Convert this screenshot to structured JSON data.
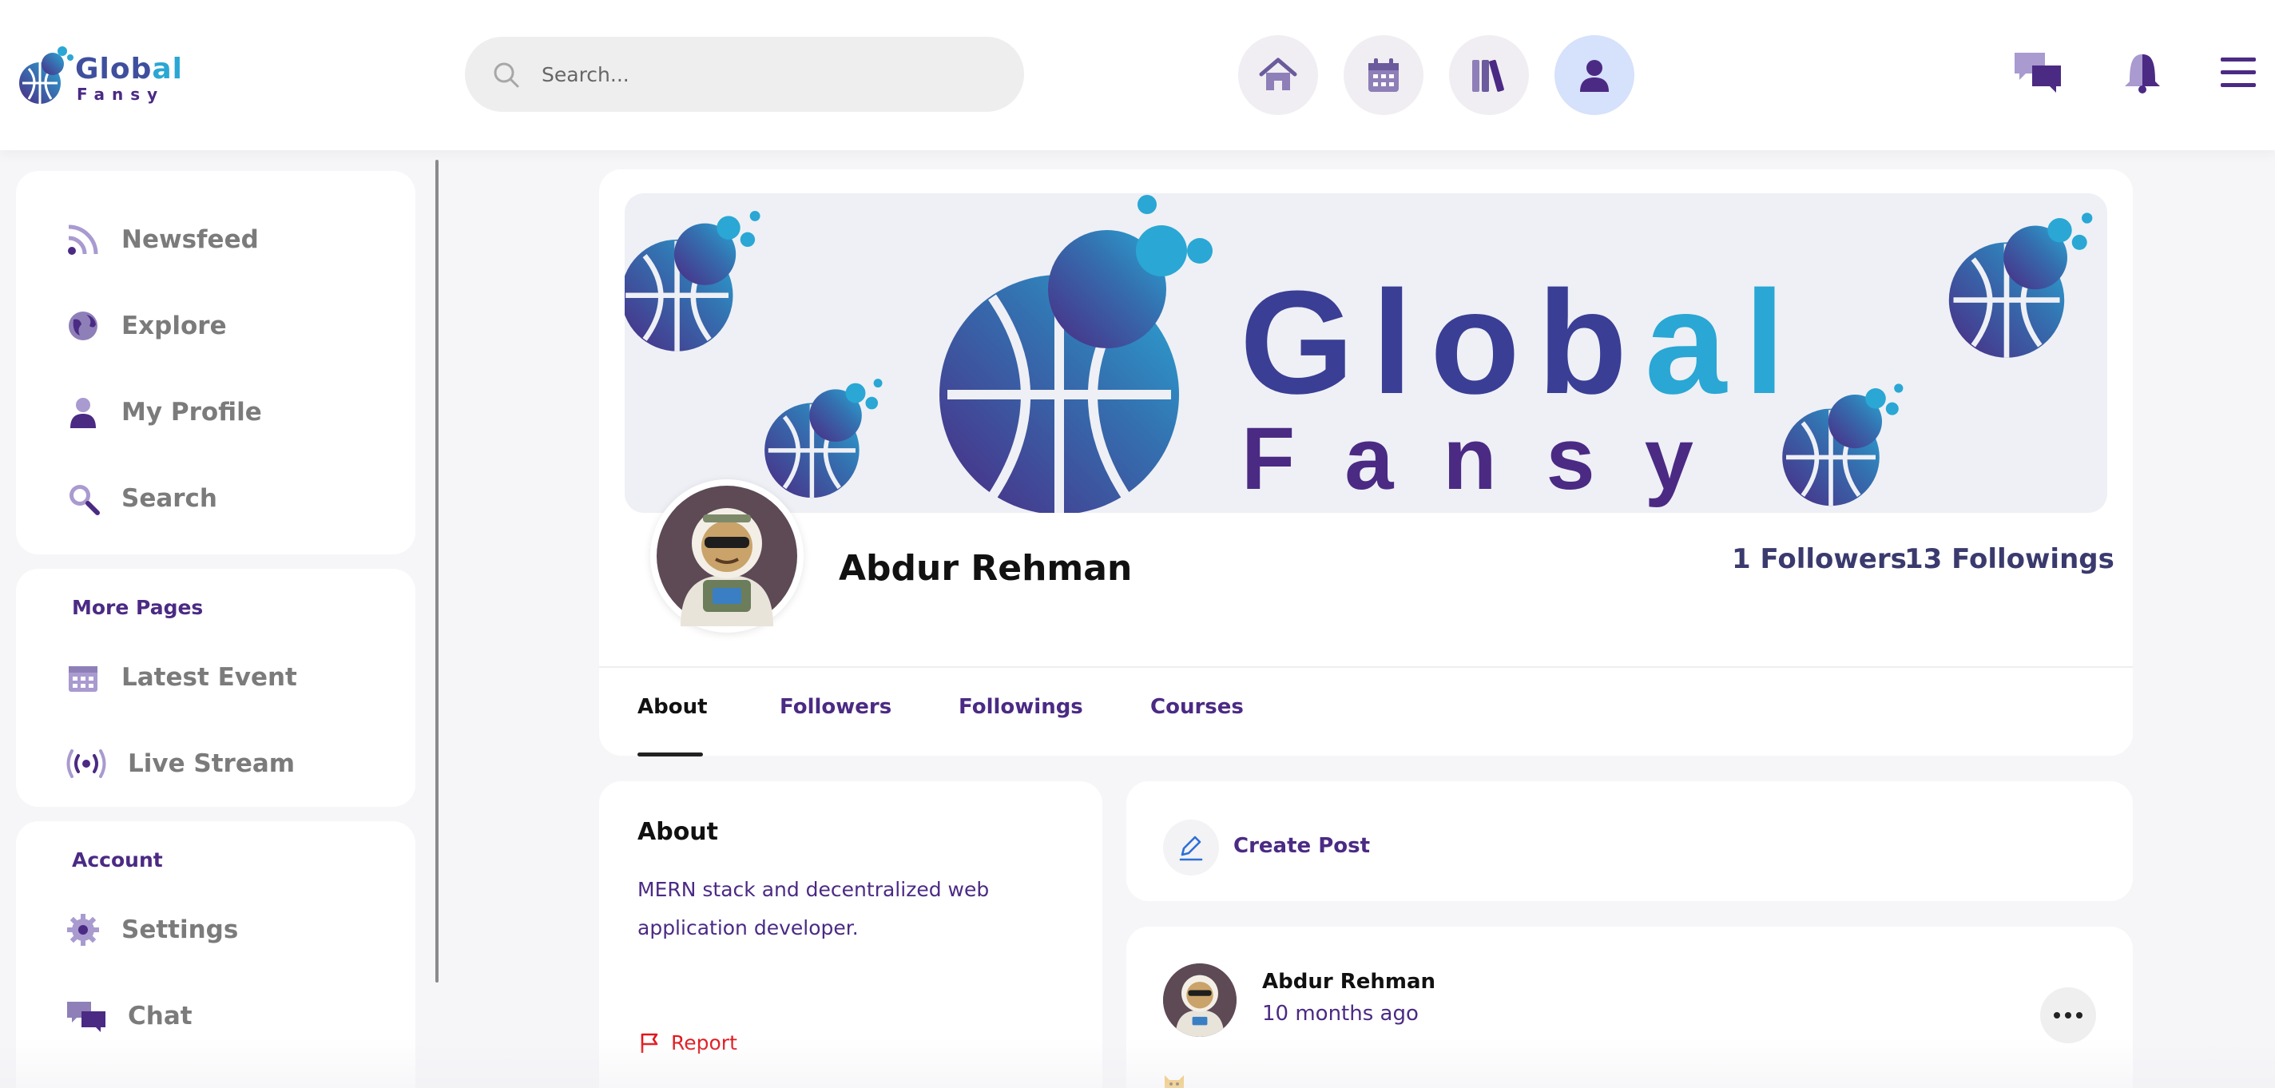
{
  "brand": {
    "word_main": "Glob",
    "word_accent": "al",
    "sub": "Fansy"
  },
  "search": {
    "placeholder": "Search..."
  },
  "colors": {
    "primary": "#4b2a84",
    "accent": "#2aa7d4",
    "danger": "#e0161b",
    "active_nav_bg": "#d6e1fb"
  },
  "header_icons": [
    "home-icon",
    "calendar-icon",
    "library-icon",
    "user-icon",
    "chat-icon",
    "bell-icon",
    "menu-icon"
  ],
  "sidebar": {
    "main_items": [
      {
        "label": "Newsfeed",
        "icon": "rss-icon"
      },
      {
        "label": "Explore",
        "icon": "globe-icon"
      },
      {
        "label": "My Profile",
        "icon": "user-icon"
      },
      {
        "label": "Search",
        "icon": "search-icon"
      }
    ],
    "more_pages": {
      "heading": "More Pages",
      "items": [
        {
          "label": "Latest Event",
          "icon": "calendar-icon"
        },
        {
          "label": "Live Stream",
          "icon": "broadcast-icon"
        }
      ]
    },
    "account": {
      "heading": "Account",
      "items": [
        {
          "label": "Settings",
          "icon": "gear-icon"
        },
        {
          "label": "Chat",
          "icon": "chat-icon"
        }
      ]
    }
  },
  "profile": {
    "name": "Abdur Rehman",
    "followers": "1 Followers",
    "followings": "13 Followings",
    "tabs": [
      "About",
      "Followers",
      "Followings",
      "Courses"
    ],
    "active_tab": "About",
    "banner": {
      "word_main": "Glob",
      "word_accent": "al",
      "sub": "Fansy"
    }
  },
  "about": {
    "title": "About",
    "text": "MERN stack and decentralized web application developer.",
    "report_label": "Report"
  },
  "create_post": {
    "label": "Create Post"
  },
  "post": {
    "author": "Abdur Rehman",
    "time": "10 months ago"
  }
}
